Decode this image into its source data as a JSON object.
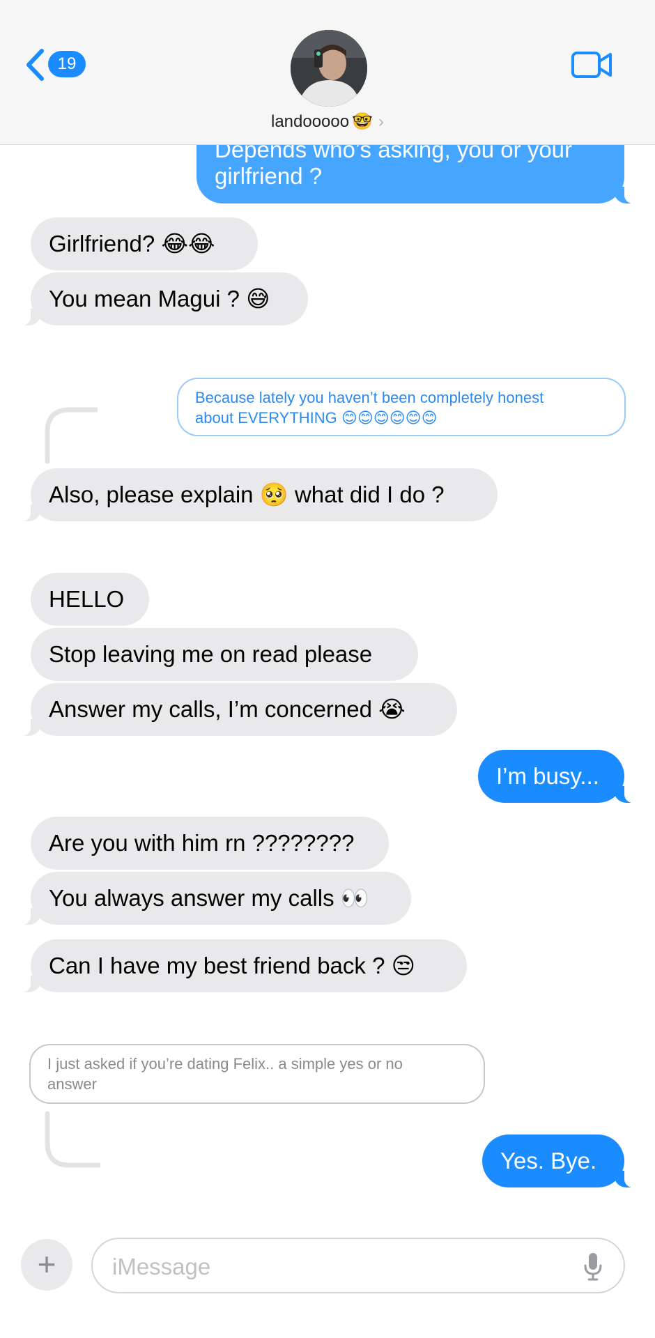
{
  "header": {
    "unread_count": "19",
    "contact_name": "landooooo",
    "contact_emoji": "🤓",
    "chevron": "›"
  },
  "messages": {
    "m1_line1": "Depends who’s asking, you or your",
    "m1_line2": "girlfriend ?",
    "m2": "Girlfriend? 😂😂",
    "m3": "You mean Magui ? 😅",
    "q1_line1": "Because lately you haven’t been completely honest",
    "q1_line2": "about EVERYTHING 😊😊😊😊😊😊",
    "m4": "Also, please explain 🥺 what did I do ?",
    "m5": "HELLO",
    "m6": "Stop leaving me on read please",
    "m7": "Answer my calls, I’m concerned 😭",
    "m8": "I’m busy...",
    "m9": "Are you with him rn ????????",
    "m10": "You always answer my calls 👀",
    "m11": "Can I have my best friend back ? 😒",
    "q2_line1": "I just asked if you’re dating Felix.. a simple yes or no",
    "q2_line2": "answer",
    "m12": "Yes. Bye."
  },
  "composer": {
    "plus_label": "+",
    "placeholder": "iMessage"
  },
  "colors": {
    "outgoing": "#1b8cff",
    "incoming": "#e9e9eb",
    "badge": "#1a8cff"
  },
  "icons": [
    "back-chevron-icon",
    "video-camera-icon",
    "plus-icon",
    "microphone-icon"
  ]
}
